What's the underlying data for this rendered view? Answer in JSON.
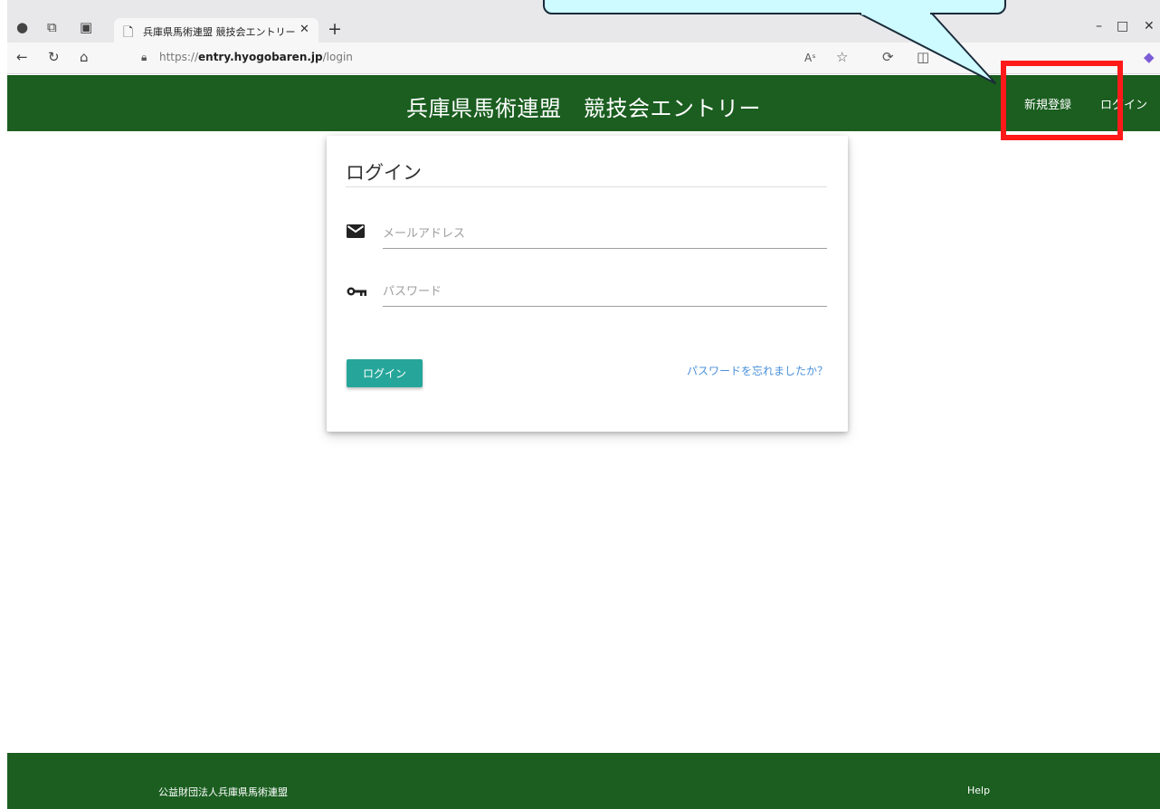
{
  "browser": {
    "tab_title": "兵庫県馬術連盟 競技会エントリー",
    "url_scheme": "https://",
    "url_host": "entry.hyogobaren.jp",
    "url_path": "/login"
  },
  "header": {
    "title": "兵庫県馬術連盟　競技会エントリー",
    "nav": {
      "register": "新規登録",
      "login": "ログイン"
    }
  },
  "login_card": {
    "title": "ログイン",
    "email_placeholder": "メールアドレス",
    "password_placeholder": "パスワード",
    "login_button": "ログイン",
    "forgot_link": "パスワードを忘れましたか？"
  },
  "footer": {
    "org": "公益財団法人兵庫県馬術連盟",
    "help": "Help"
  },
  "annotations": {
    "highlight_color": "#ff1a1a",
    "callout_color": "#cdfbff"
  },
  "colors": {
    "header_bg": "#1b5e20",
    "button_bg": "#26a69a",
    "link": "#4a90d9"
  }
}
